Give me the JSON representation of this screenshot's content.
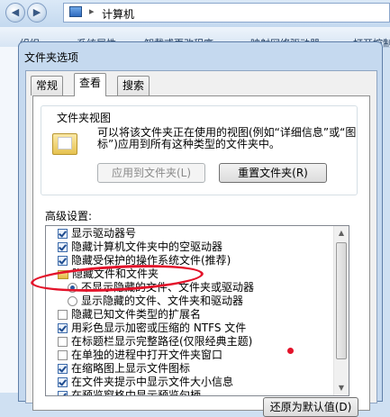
{
  "explorer": {
    "location": "计算机",
    "toolbar": [
      "组织 ▾",
      "系统属性",
      "卸载或更改程序",
      "映射网络驱动器",
      "打开控制"
    ]
  },
  "dialog": {
    "title": "文件夹选项",
    "tabs": [
      {
        "label": "常规",
        "active": false
      },
      {
        "label": "查看",
        "active": true
      },
      {
        "label": "搜索",
        "active": false
      }
    ],
    "folder_views": {
      "group_label": "文件夹视图",
      "description": "可以将该文件夹正在使用的视图(例如“详细信息”或“图标”)应用到所有这种类型的文件夹中。",
      "apply_button": "应用到文件夹(L)",
      "reset_button": "重置文件夹(R)"
    },
    "advanced": {
      "label": "高级设置:",
      "items": [
        {
          "type": "checkbox",
          "checked": true,
          "level": 1,
          "label": "显示驱动器号"
        },
        {
          "type": "checkbox",
          "checked": true,
          "level": 1,
          "label": "隐藏计算机文件夹中的空驱动器"
        },
        {
          "type": "checkbox",
          "checked": true,
          "level": 1,
          "label": "隐藏受保护的操作系统文件(推荐)"
        },
        {
          "type": "folder",
          "level": 1,
          "label": "隐藏文件和文件夹"
        },
        {
          "type": "radio",
          "selected": true,
          "level": 2,
          "label": "不显示隐藏的文件、文件夹或驱动器"
        },
        {
          "type": "radio",
          "selected": false,
          "level": 2,
          "label": "显示隐藏的文件、文件夹和驱动器"
        },
        {
          "type": "checkbox",
          "checked": false,
          "level": 1,
          "label": "隐藏已知文件类型的扩展名"
        },
        {
          "type": "checkbox",
          "checked": true,
          "level": 1,
          "label": "用彩色显示加密或压缩的 NTFS 文件"
        },
        {
          "type": "checkbox",
          "checked": false,
          "level": 1,
          "label": "在标题栏显示完整路径(仅限经典主题)"
        },
        {
          "type": "checkbox",
          "checked": false,
          "level": 1,
          "label": "在单独的进程中打开文件夹窗口"
        },
        {
          "type": "checkbox",
          "checked": true,
          "level": 1,
          "label": "在缩略图上显示文件图标"
        },
        {
          "type": "checkbox",
          "checked": true,
          "level": 1,
          "label": "在文件夹提示中显示文件大小信息"
        },
        {
          "type": "checkbox",
          "checked": true,
          "level": 1,
          "label": "在预览窗格中显示预览句柄"
        }
      ]
    },
    "restore_defaults_button": "还原为默认值(D)"
  },
  "colors": {
    "annotation": "#e3132a",
    "accent": "#2a5aa0"
  }
}
